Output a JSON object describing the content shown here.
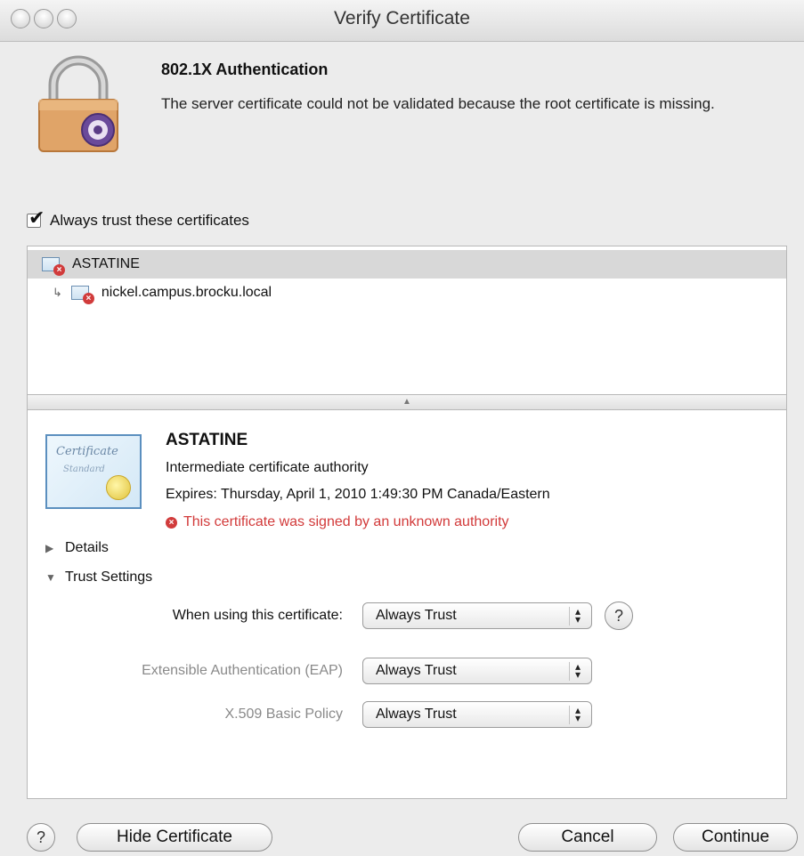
{
  "window": {
    "title": "Verify Certificate"
  },
  "alert": {
    "heading": "802.1X Authentication",
    "message": "The server certificate could not be validated because the root certificate is missing."
  },
  "trust_checkbox": {
    "label": "Always trust these certificates",
    "checked": true
  },
  "certificate_tree": {
    "items": [
      {
        "label": "ASTATINE",
        "selected": true,
        "icon": "invalid-certificate-icon"
      },
      {
        "label": "nickel.campus.brocku.local",
        "selected": false,
        "icon": "invalid-certificate-icon"
      }
    ]
  },
  "certificate": {
    "name": "ASTATINE",
    "kind": "Intermediate certificate authority",
    "expires": "Expires: Thursday, April 1, 2010 1:49:30 PM Canada/Eastern",
    "warning": "This certificate was signed by an unknown authority",
    "warning_color": "#d23a3a",
    "icon": "certificate-standard-icon"
  },
  "sections": {
    "details": {
      "label": "Details",
      "expanded": false
    },
    "trust_settings": {
      "label": "Trust Settings",
      "expanded": true
    }
  },
  "trust_policies": [
    {
      "label": "When using this certificate:",
      "value": "Always Trust",
      "enabled": true
    },
    {
      "label": "Extensible Authentication (EAP)",
      "value": "Always Trust",
      "enabled": false
    },
    {
      "label": "X.509 Basic Policy",
      "value": "Always Trust",
      "enabled": false
    }
  ],
  "buttons": {
    "help": "?",
    "hide_certificate": "Hide Certificate",
    "cancel": "Cancel",
    "continue": "Continue"
  }
}
